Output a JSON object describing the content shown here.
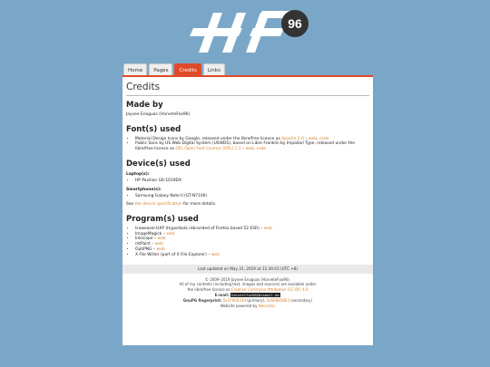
{
  "logo": {
    "text": "HF",
    "badge": "96",
    "color": "#ffffff",
    "badge_bg": "#333333"
  },
  "tabs": [
    {
      "label": "Home"
    },
    {
      "label": "Pages"
    },
    {
      "label": "Credits",
      "active": true
    },
    {
      "label": "Links"
    }
  ],
  "accent": "#e04a2a",
  "link_color": "#d9822b",
  "page_title": "Credits",
  "made_by": {
    "heading": "Made by",
    "text": "Jayvee Enaguas (HarveteFox96)"
  },
  "fonts": {
    "heading": "Font(s) used",
    "items": [
      {
        "text": "Material Design Icons by Google, released under the libre/free licence as ",
        "links": [
          "Apache 2.0",
          " – ",
          "web",
          ", ",
          "code"
        ]
      },
      {
        "text": "Public Sans by US Web Digital System (USWDS), based on Libre Franklin by Impallari Type, released under the libre/free licence as ",
        "links": [
          "OFL Open Font Licence (OFL) 1.1",
          " – ",
          "web",
          ", ",
          "code"
        ]
      }
    ]
  },
  "devices": {
    "heading": "Device(s) used",
    "laptop_label": "Laptop(s):",
    "laptop": "HP Pavilion G6-1019DX",
    "smartphone_label": "Smartphone(s):",
    "smartphone": "Samsung Galaxy Note II (GT-N7100)",
    "see_prefix": "See ",
    "see_link": "the device specification",
    "see_suffix": " for more details."
  },
  "programs": {
    "heading": "Program(s) used",
    "items": [
      {
        "name": "Iceweasel-UXP (Hyperbola rebranded of Firefox based 52 ESR)",
        "sep": " – ",
        "link": "web"
      },
      {
        "name": "ImageMagick",
        "sep": " – ",
        "link": "web"
      },
      {
        "name": "Inkscape",
        "sep": " – ",
        "link": "web"
      },
      {
        "name": "mtPaint",
        "sep": " – ",
        "link": "web"
      },
      {
        "name": "OptiPNG",
        "sep": " – ",
        "link": "web"
      },
      {
        "name": "X File Writer (part of X File Explorer)",
        "sep": " – ",
        "link": "web"
      }
    ]
  },
  "footer": {
    "updated": "Last updated on May 31, 2019 at 11:30:43 (UTC +8)",
    "copyright": "© 2009–2019 Jayvee Enaguas (HarveteFox96).",
    "rights": "All of my contents (including text, images and sources) are available under",
    "licence_prefix": "the libre/free licence as ",
    "licence_link": "Creative Commons Attribution (CC-BY) 4.0",
    "email_label": "E-mail:",
    "email": "harvettfox96@dismail.de",
    "gpg_label": "GnuPG fingerprint:",
    "gpg_primary": "0x37906339",
    "gpg_primary_note": " (primary), ",
    "gpg_secondary": "0x6E8B58E3",
    "gpg_secondary_note": " (secondary)",
    "powered_prefix": "Website powered by ",
    "powered_link": "Neocities"
  }
}
